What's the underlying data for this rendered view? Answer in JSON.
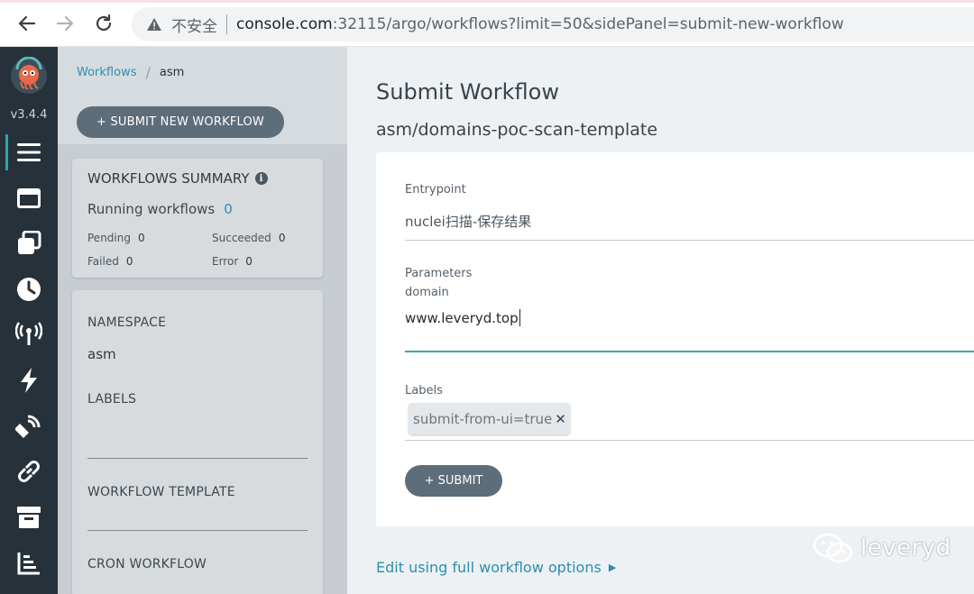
{
  "browser": {
    "security_label": "不安全",
    "url_host": "console.com",
    "url_rest": ":32115/argo/workflows?limit=50&sidePanel=submit-new-workflow"
  },
  "rail": {
    "version": "v3.4.4",
    "items": [
      "menu-icon",
      "window-icon",
      "stack-icon",
      "clock-icon",
      "antenna-icon",
      "lightning-icon",
      "satellite-icon",
      "link-icon",
      "archive-icon",
      "chart-icon"
    ]
  },
  "breadcrumb": {
    "link": "Workflows",
    "separator": "/",
    "current": "asm"
  },
  "submit_new_label": "+ SUBMIT NEW WORKFLOW",
  "summary": {
    "title": "WORKFLOWS SUMMARY",
    "running_label": "Running workflows",
    "running_count": "0",
    "pending_label": "Pending",
    "pending_value": "0",
    "succeeded_label": "Succeeded",
    "succeeded_value": "0",
    "failed_label": "Failed",
    "failed_value": "0",
    "error_label": "Error",
    "error_value": "0"
  },
  "filters": {
    "namespace_label": "NAMESPACE",
    "namespace_value": "asm",
    "labels_label": "LABELS",
    "template_label": "WORKFLOW TEMPLATE",
    "cron_label": "CRON WORKFLOW"
  },
  "panel": {
    "title": "Submit Workflow",
    "subtitle": "asm/domains-poc-scan-template",
    "entrypoint_label": "Entrypoint",
    "entrypoint_value": "nuclei扫描-保存结果",
    "parameters_label": "Parameters",
    "param_name": "domain",
    "param_value": "www.leveryd.top",
    "labels_label": "Labels",
    "label_chip": "submit-from-ui=true",
    "chip_remove": "✕",
    "submit_label": "+ SUBMIT",
    "edit_link": "Edit using full workflow options",
    "edit_arrow": "▶"
  },
  "watermark": {
    "text": "leveryd"
  },
  "colors": {
    "accent": "#2c8eb0",
    "focus": "#3aa9a6",
    "button": "#5d6d79",
    "rail": "#26313a"
  }
}
